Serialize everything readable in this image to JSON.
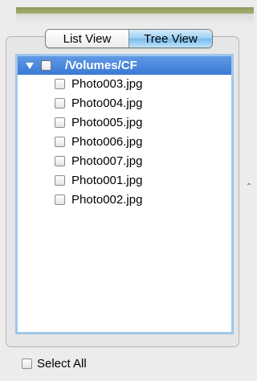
{
  "view_switch": {
    "list_label": "List View",
    "tree_label": "Tree View",
    "selected": "Tree View"
  },
  "tree": {
    "root_label": "/Volumes/CF",
    "files": [
      {
        "label": "Photo003.jpg"
      },
      {
        "label": "Photo004.jpg"
      },
      {
        "label": "Photo005.jpg"
      },
      {
        "label": "Photo006.jpg"
      },
      {
        "label": "Photo007.jpg"
      },
      {
        "label": "Photo001.jpg"
      },
      {
        "label": "Photo002.jpg"
      }
    ]
  },
  "select_all_label": "Select All",
  "colors": {
    "selection": "#3a78d4",
    "focus_ring": "#a0c7ea",
    "header_bar": "#97a465"
  }
}
